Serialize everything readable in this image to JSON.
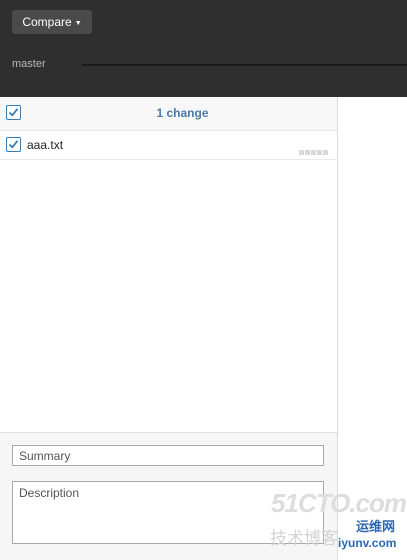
{
  "toolbar": {
    "compare_label": "Compare",
    "compare_caret": "▼"
  },
  "branch": {
    "name": "master"
  },
  "changes": {
    "header_label": "1 change",
    "all_selected": true,
    "files": [
      {
        "name": "aaa.txt",
        "selected": true
      }
    ]
  },
  "commit": {
    "summary_placeholder": "Summary",
    "description_placeholder": "Description"
  },
  "watermark": {
    "line1": "51CTO.com",
    "line2": "技术博客",
    "line3": "运维网",
    "line4": "iyunv.com"
  },
  "colors": {
    "accent": "#4b7aa6",
    "checkbox": "#3d7ab0",
    "topbar": "#2f2f2f"
  },
  "icons": {
    "checkbox": "check-icon",
    "dropdown": "caret-down-icon"
  }
}
